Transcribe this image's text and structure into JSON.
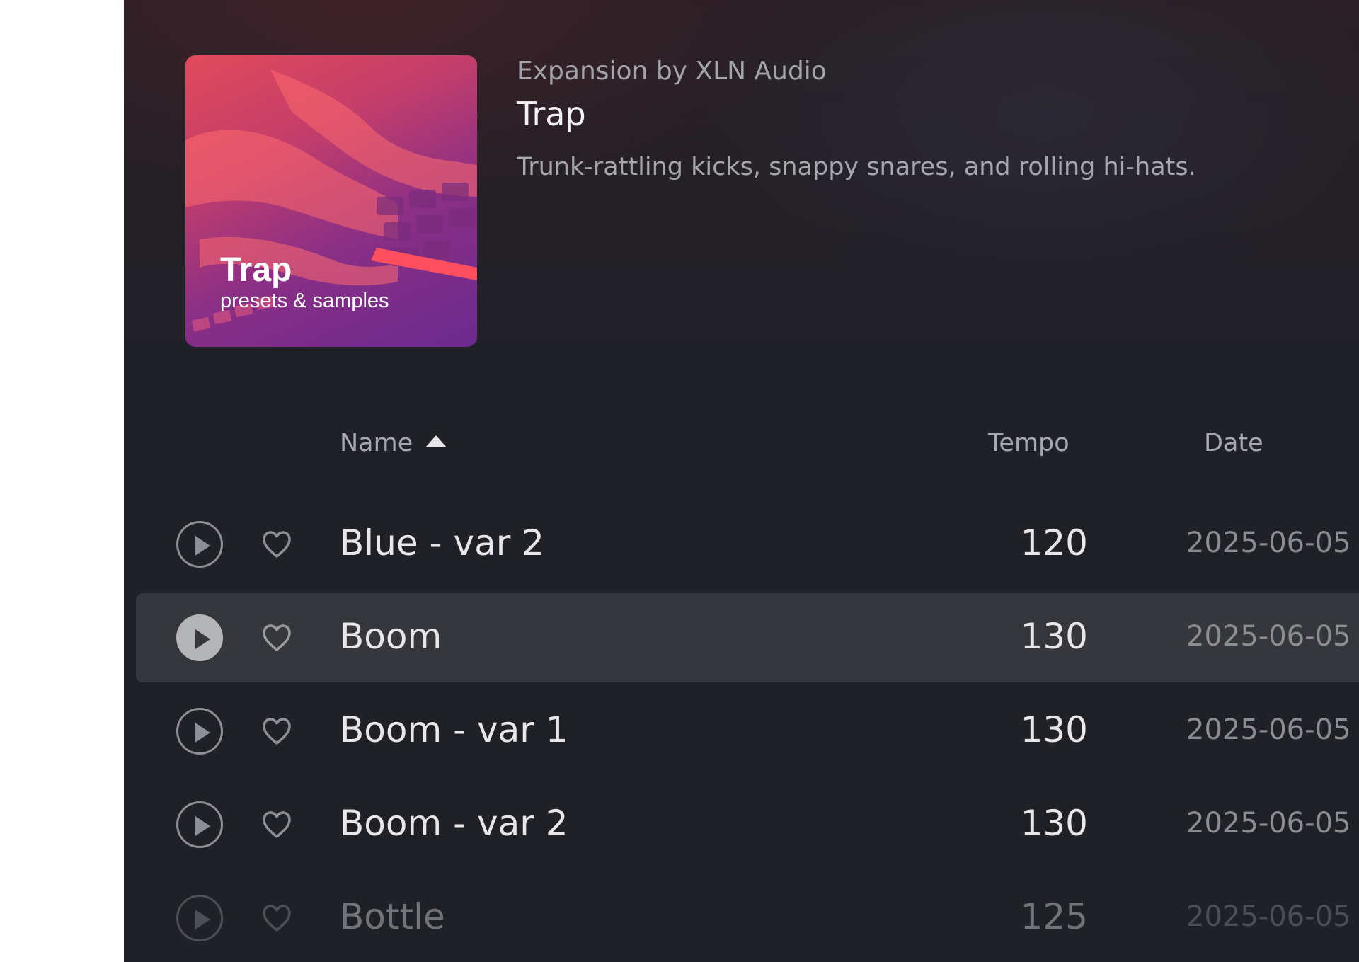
{
  "header": {
    "provider": "Expansion by XLN Audio",
    "title": "Trap",
    "description": "Trunk-rattling kicks, snappy snares, and rolling hi-hats."
  },
  "artwork": {
    "title": "Trap",
    "subtitle": "presets & samples",
    "colors": {
      "top": "#e04a5a",
      "bottom": "#6a2a8e"
    }
  },
  "table": {
    "columns": {
      "name": "Name",
      "tempo": "Tempo",
      "date": "Date"
    },
    "sort": {
      "column": "Name",
      "direction": "ascending"
    },
    "rows": [
      {
        "name": "Blue - var 2",
        "tempo": "120",
        "date": "2025-06-05",
        "selected": false
      },
      {
        "name": "Boom",
        "tempo": "130",
        "date": "2025-06-05",
        "selected": true
      },
      {
        "name": "Boom - var 1",
        "tempo": "130",
        "date": "2025-06-05",
        "selected": false
      },
      {
        "name": "Boom - var 2",
        "tempo": "130",
        "date": "2025-06-05",
        "selected": false
      },
      {
        "name": "Bottle",
        "tempo": "125",
        "date": "2025-06-05",
        "selected": false
      }
    ]
  },
  "icons": {
    "play": "play-icon",
    "favorite": "heart-icon",
    "sort": "sort-ascending-icon"
  },
  "colors": {
    "background": "#1f2127",
    "selected_row": "#35373c",
    "text": "#e7e7ea",
    "muted": "#8c8d92"
  }
}
